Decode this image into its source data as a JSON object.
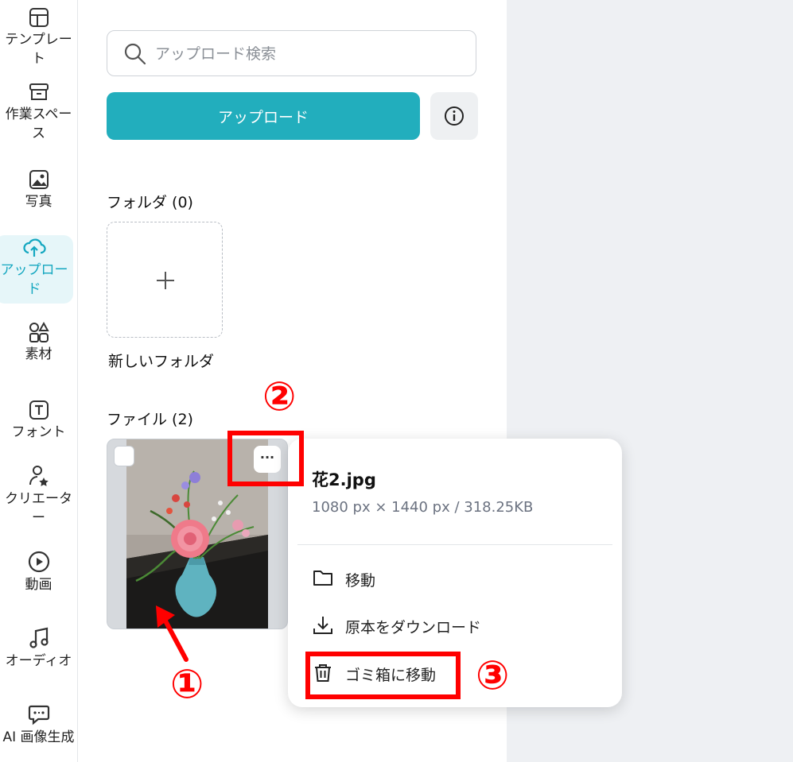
{
  "sidebar": {
    "items": [
      {
        "label": "テンプレー\nト",
        "icon": "template-icon"
      },
      {
        "label": "作業スペー\nス",
        "icon": "archive-icon"
      },
      {
        "label": "写真",
        "icon": "image-icon"
      },
      {
        "label": "アップロー\nド",
        "icon": "cloud-upload-icon",
        "active": true
      },
      {
        "label": "素材",
        "icon": "shapes-icon"
      },
      {
        "label": "フォント",
        "icon": "text-icon"
      },
      {
        "label": "クリエータ\nー",
        "icon": "creator-icon"
      },
      {
        "label": "動画",
        "icon": "play-icon"
      },
      {
        "label": "オーディオ",
        "icon": "music-icon"
      },
      {
        "label": "AI 画像生成",
        "icon": "ai-chat-icon"
      }
    ]
  },
  "panel": {
    "search_placeholder": "アップロード検索",
    "upload_button": "アップロード",
    "folders_title": "フォルダ (0)",
    "new_folder": "新しいフォルダ",
    "files_title": "ファイル (2)",
    "more_label": "···"
  },
  "popup": {
    "file_name": "花2.jpg",
    "file_meta": "1080 px × 1440 px / 318.25KB",
    "items": [
      {
        "label": "移動",
        "icon": "folder-icon"
      },
      {
        "label": "原本をダウンロード",
        "icon": "download-icon"
      },
      {
        "label": "ゴミ箱に移動",
        "icon": "trash-icon"
      }
    ]
  },
  "annotations": {
    "marker_1": "①",
    "marker_2": "②",
    "marker_3": "③"
  },
  "colors": {
    "accent": "#22aebd",
    "active_nav_bg": "#e6f6f9",
    "annotation": "#ff0000"
  }
}
